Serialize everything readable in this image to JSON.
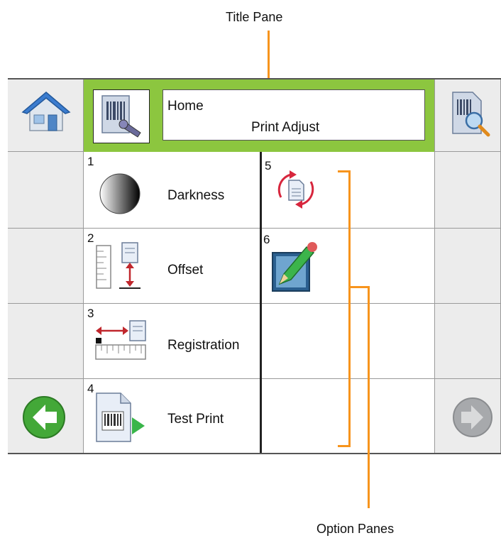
{
  "callouts": {
    "title_pane": "Title Pane",
    "option_panes": "Option Panes"
  },
  "title_pane": {
    "path": "Home",
    "title": "Print Adjust"
  },
  "options": [
    {
      "number": "1",
      "label": "Darkness",
      "icon": "darkness-gradient-icon"
    },
    {
      "number": "2",
      "label": "Offset",
      "icon": "offset-ruler-icon"
    },
    {
      "number": "3",
      "label": "Registration",
      "icon": "registration-ruler-icon"
    },
    {
      "number": "4",
      "label": "Test Print",
      "icon": "test-print-barcode-icon"
    },
    {
      "number": "5",
      "label": "",
      "icon": "refresh-document-icon"
    },
    {
      "number": "6",
      "label": "",
      "icon": "edit-document-pen-icon"
    }
  ],
  "nav": {
    "home_icon": "home-icon",
    "search_icon": "document-search-icon",
    "back_icon": "back-arrow-icon",
    "forward_icon": "forward-arrow-icon"
  },
  "colors": {
    "title_pane_border": "#8cc63f",
    "callout_line": "#f7941d",
    "grid_background": "#ececec",
    "back_button": "#43a838",
    "forward_button_disabled": "#a7a9ac"
  }
}
